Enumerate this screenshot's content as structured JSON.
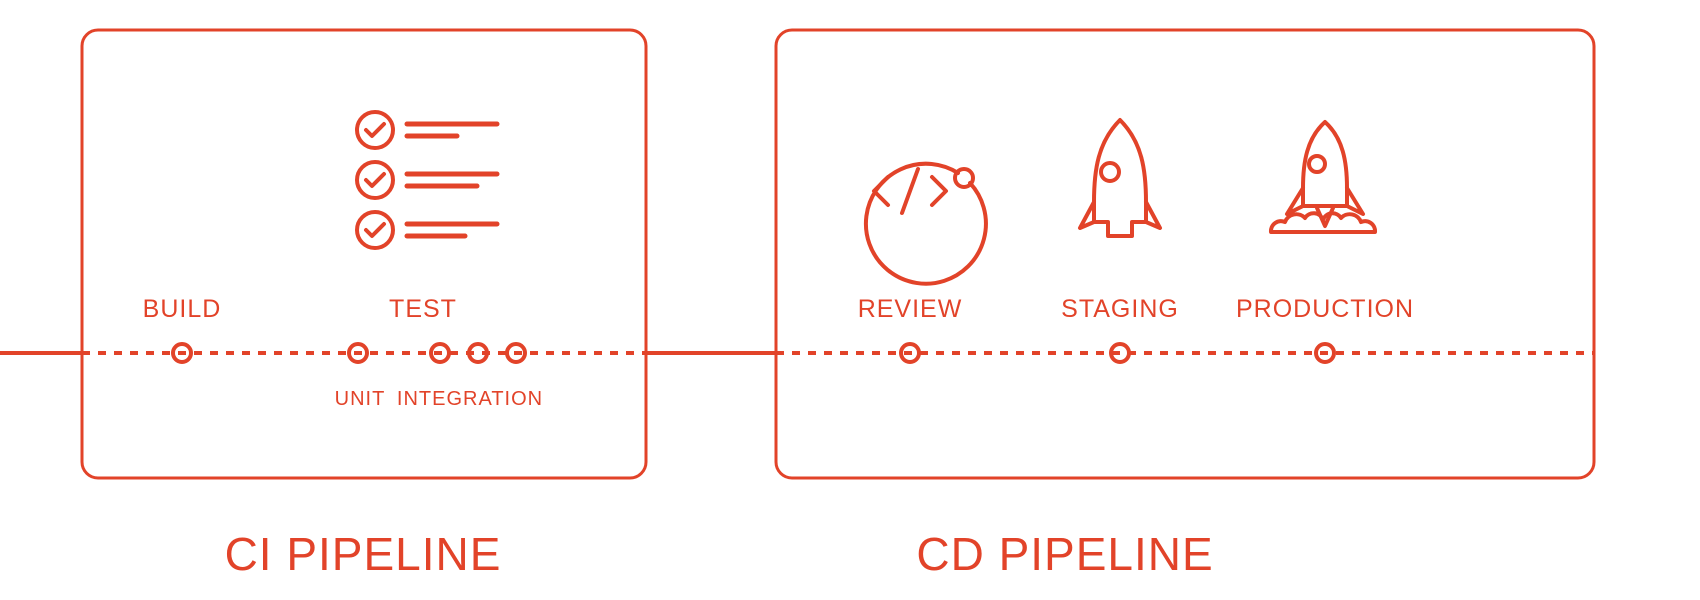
{
  "color": {
    "accent": "#e24329"
  },
  "ci": {
    "title": "CI PIPELINE",
    "stages": {
      "build": {
        "label": "BUILD"
      },
      "test": {
        "label": "TEST",
        "sub": {
          "unit": "UNIT",
          "integration": "INTEGRATION"
        }
      }
    }
  },
  "cd": {
    "title": "CD PIPELINE",
    "stages": {
      "review": {
        "label": "REVIEW"
      },
      "staging": {
        "label": "STAGING"
      },
      "production": {
        "label": "PRODUCTION"
      }
    }
  }
}
